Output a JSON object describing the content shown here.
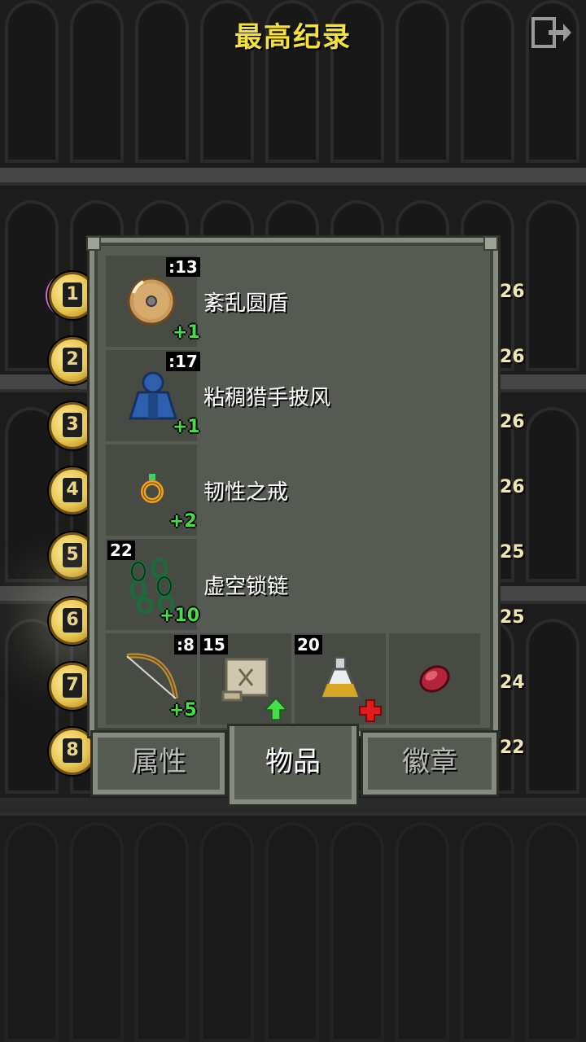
{
  "header": {
    "title": "最高纪录",
    "exit_icon": "exit-icon"
  },
  "ranks": [
    {
      "num": "1",
      "depth": "26"
    },
    {
      "num": "2",
      "depth": "26"
    },
    {
      "num": "3",
      "depth": "26"
    },
    {
      "num": "4",
      "depth": "26"
    },
    {
      "num": "5",
      "depth": "25"
    },
    {
      "num": "6",
      "depth": "25"
    },
    {
      "num": "7",
      "depth": "24"
    },
    {
      "num": "8",
      "depth": "22"
    }
  ],
  "equipment": [
    {
      "name": "紊乱圆盾",
      "icon": "round-shield-icon",
      "tag": ":13",
      "level": "+1"
    },
    {
      "name": "粘稠猎手披风",
      "icon": "cloak-icon",
      "tag": ":17",
      "level": "+1"
    },
    {
      "name": "韧性之戒",
      "icon": "ring-icon",
      "tag": "",
      "level": "+2"
    },
    {
      "name": "虚空锁链",
      "icon": "chains-icon",
      "tag": "22",
      "level": "+10"
    }
  ],
  "quickslots": [
    {
      "icon": "bow-icon",
      "tag": ":8",
      "level": "+5"
    },
    {
      "icon": "scroll-icon",
      "tag": "15",
      "badge": "upgrade-arrow-icon"
    },
    {
      "icon": "potion-icon",
      "tag": "20",
      "badge": "healing-cross-icon"
    },
    {
      "icon": "meat-icon",
      "tag": ""
    }
  ],
  "tabs": {
    "stats": "属性",
    "items": "物品",
    "badges": "徽章",
    "active": "items"
  },
  "colors": {
    "title": "#f5e33a",
    "level": "#46e046",
    "panel": "#555a52"
  }
}
